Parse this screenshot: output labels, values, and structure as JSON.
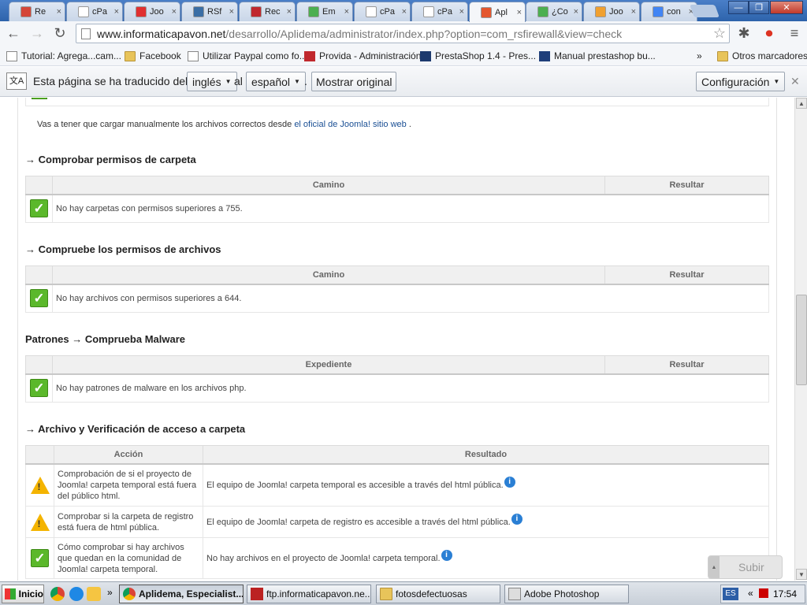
{
  "tabs": [
    {
      "label": "Re",
      "color": "#d44638"
    },
    {
      "label": "cPa",
      "color": "#ffffff"
    },
    {
      "label": "Joo",
      "color": "#e03030"
    },
    {
      "label": "RSf",
      "color": "#3a6ea5"
    },
    {
      "label": "Rec",
      "color": "#c0282d"
    },
    {
      "label": "Em",
      "color": "#4caf50"
    },
    {
      "label": "cPa",
      "color": "#ffffff"
    },
    {
      "label": "cPa",
      "color": "#ffffff"
    },
    {
      "label": "Apl",
      "color": "#e4572e",
      "active": true
    },
    {
      "label": "¿Co",
      "color": "#4caf50"
    },
    {
      "label": "Joo",
      "color": "#f0a030"
    },
    {
      "label": "con",
      "color": "#4285f4"
    }
  ],
  "tab_close": "×",
  "window": {
    "minimize": "—",
    "maximize": "❐",
    "close": "✕"
  },
  "url": {
    "host": "www.informaticapavon.net",
    "path": "/desarrollo/Aplidema/administrator/index.php?option=com_rsfirewall&view=check"
  },
  "bookmarks": {
    "items": [
      {
        "label": "Tutorial: Agrega...cam...",
        "icon": "page"
      },
      {
        "label": "Facebook",
        "icon": "folder"
      },
      {
        "label": "Utilizar Paypal como fo...",
        "icon": "page"
      },
      {
        "label": "Provida - Administración",
        "icon": "provida"
      },
      {
        "label": "PrestaShop 1.4 - Pres...",
        "icon": "prestashop"
      },
      {
        "label": "Manual prestashop bu...",
        "icon": "manual"
      }
    ],
    "overflow": "»",
    "other": "Otros marcadores"
  },
  "translate": {
    "prefix": "Esta página se ha traducido del",
    "from": "inglés",
    "middle": "al",
    "to": "español",
    "dot": ".",
    "show_original": "Mostrar original",
    "settings": "Configuración",
    "close": "✕"
  },
  "content": {
    "note_text": "Vas a tener que cargar manualmente los archivos correctos desde ",
    "note_link": "el oficial de Joomla! sitio web",
    "note_end": " .",
    "sections": [
      {
        "title": "→ Comprobar permisos de carpeta",
        "col1": "Camino",
        "col2": "Resultar",
        "row": "No hay carpetas con permisos superiores a 755."
      },
      {
        "title": "→ Compruebe los permisos de archivos",
        "col1": "Camino",
        "col2": "Resultar",
        "row": "No hay archivos con permisos superiores a 644."
      },
      {
        "title": "Patrones → Comprueba Malware",
        "col1": "Expediente",
        "col2": "Resultar",
        "row": "No hay patrones de malware en los archivos php."
      }
    ],
    "access": {
      "title": "→ Archivo y Verificación de acceso a carpeta",
      "col1": "Acción",
      "col2": "Resultado",
      "rows": [
        {
          "status": "warning",
          "action": "Comprobación de si el proyecto de Joomla! carpeta temporal está fuera del público html.",
          "result": "El equipo de Joomla! carpeta temporal es accesible a través del html pública."
        },
        {
          "status": "warning",
          "action": "Comprobar si la carpeta de registro está fuera de html pública.",
          "result": "El equipo de Joomla! carpeta de registro es accesible a través del html pública."
        },
        {
          "status": "ok",
          "action": "Cómo comprobar si hay archivos que quedan en la comunidad de Joomla! carpeta temporal.",
          "result": "No hay archivos en el proyecto de Joomla! carpeta temporal."
        }
      ]
    },
    "scroll_top_button": "Subir"
  },
  "taskbar": {
    "start": "Inicio",
    "overflow": "»",
    "tasks": [
      {
        "label": "Aplidema, Especialist...",
        "active": true
      },
      {
        "label": "ftp.informaticapavon.ne..."
      },
      {
        "label": "fotosdefectuosas"
      },
      {
        "label": "Adobe Photoshop"
      }
    ],
    "lang": "ES",
    "tray_overflow": "«",
    "clock": "17:54"
  }
}
